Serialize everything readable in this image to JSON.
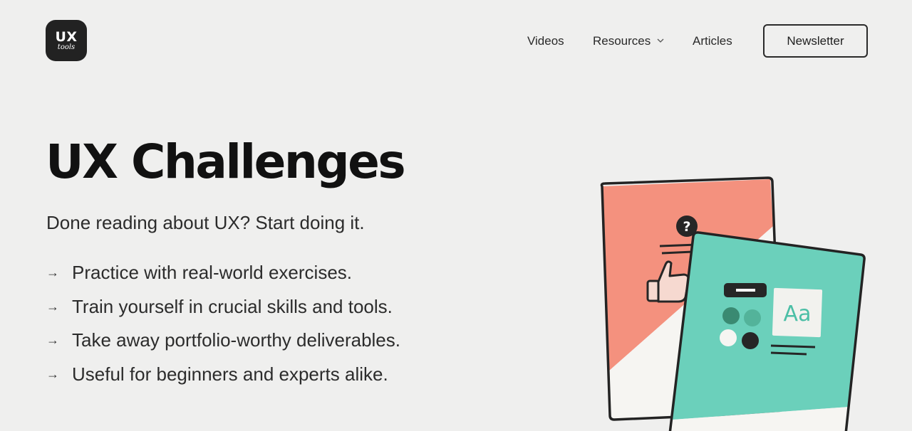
{
  "header": {
    "logo": {
      "main": "UX",
      "sub": "tools"
    },
    "nav": {
      "videos": "Videos",
      "resources": "Resources",
      "articles": "Articles"
    },
    "newsletter_label": "Newsletter"
  },
  "hero": {
    "title": "UX Challenges",
    "subtitle": "Done reading about UX? Start doing it.",
    "features": [
      "Practice with real-world exercises.",
      "Train yourself in crucial skills and tools.",
      "Take away portfolio-worthy deliverables.",
      "Useful for beginners and experts alike."
    ],
    "arrow_glyph": "→"
  },
  "illustration": {
    "card_back_color": "#f4917e",
    "card_front_color": "#6bd0bb",
    "question_mark": "?",
    "type_sample": "Aa",
    "icons": [
      "question-icon",
      "thumbs-up-icon",
      "color-swatches-icon",
      "typography-icon"
    ]
  }
}
